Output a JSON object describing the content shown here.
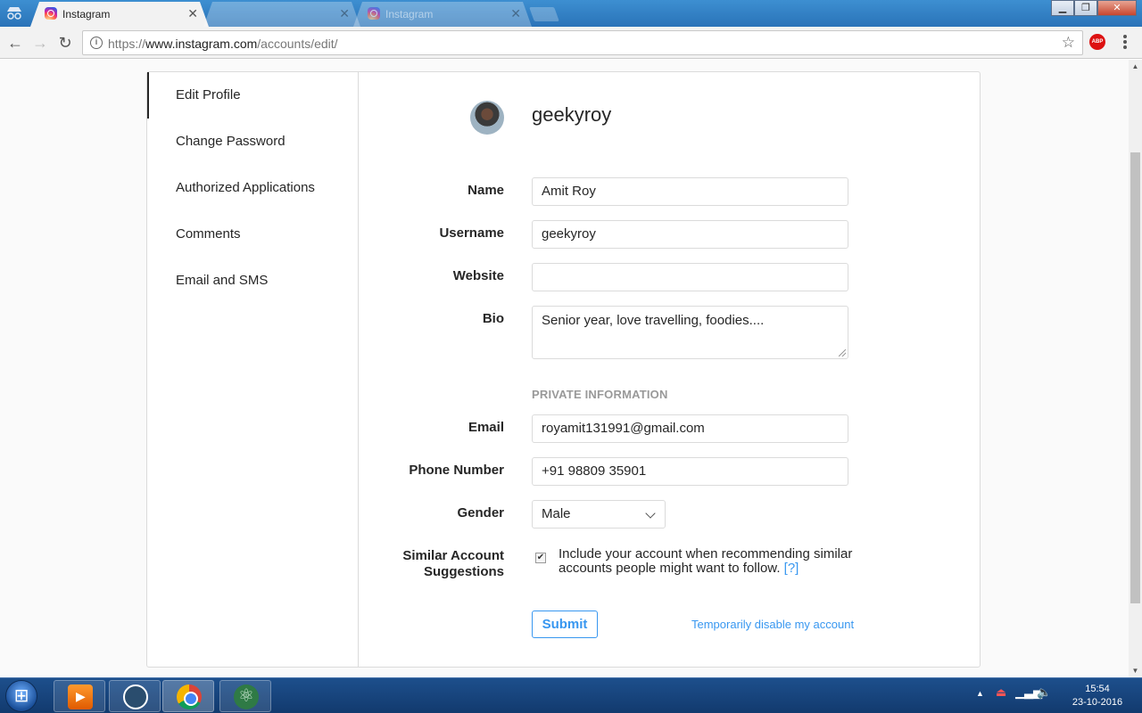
{
  "browser": {
    "tabs": [
      {
        "title": "Instagram",
        "active": true
      },
      {
        "title": "",
        "active": false
      },
      {
        "title": "Instagram",
        "active": false
      }
    ],
    "url_scheme": "https://",
    "url_host": "www.instagram.com",
    "url_path": "/accounts/edit/",
    "extension_abp": "ABP"
  },
  "sidebar": {
    "items": [
      {
        "label": "Edit Profile"
      },
      {
        "label": "Change Password"
      },
      {
        "label": "Authorized Applications"
      },
      {
        "label": "Comments"
      },
      {
        "label": "Email and SMS"
      }
    ]
  },
  "profile": {
    "username": "geekyroy"
  },
  "form": {
    "name_label": "Name",
    "name_value": "Amit Roy",
    "username_label": "Username",
    "username_value": "geekyroy",
    "website_label": "Website",
    "website_value": "",
    "bio_label": "Bio",
    "bio_value": "Senior year, love travelling, foodies....",
    "private_section": "PRIVATE INFORMATION",
    "email_label": "Email",
    "email_value": "royamit131991@gmail.com",
    "phone_label": "Phone Number",
    "phone_value": "+91 98809 35901",
    "gender_label": "Gender",
    "gender_value": "Male",
    "suggestions_label_1": "Similar Account",
    "suggestions_label_2": "Suggestions",
    "suggestions_checked": true,
    "suggestions_text": "Include your account when recommending similar accounts people might want to follow.",
    "suggestions_help": "[?]",
    "submit_label": "Submit",
    "disable_label": "Temporarily disable my account"
  },
  "taskbar": {
    "time": "15:54",
    "date": "23-10-2016"
  },
  "colors": {
    "link": "#3897f0",
    "text": "#262626",
    "border": "#dbdbdb",
    "section": "#999999"
  }
}
